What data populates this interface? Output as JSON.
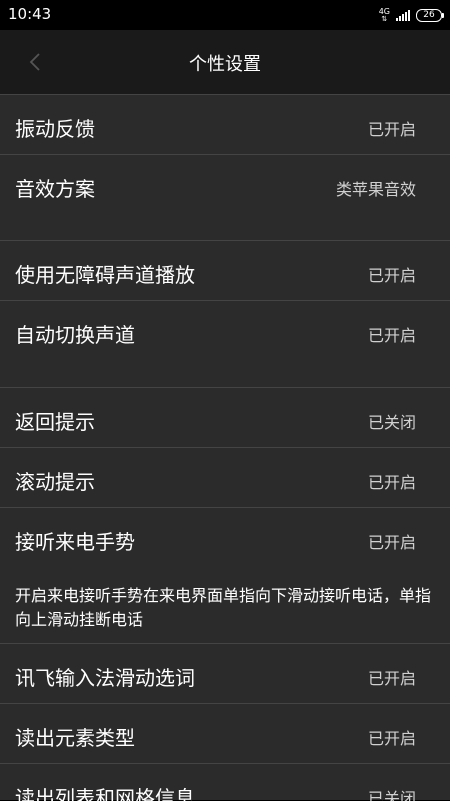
{
  "status_bar": {
    "time": "10:43",
    "network": "4G",
    "battery": "26"
  },
  "header": {
    "title": "个性设置"
  },
  "settings": [
    {
      "label": "振动反馈",
      "value": "已开启"
    },
    {
      "label": "音效方案",
      "value": "类苹果音效"
    },
    {
      "label": "使用无障碍声道播放",
      "value": "已开启"
    },
    {
      "label": "自动切换声道",
      "value": "已开启"
    },
    {
      "label": "返回提示",
      "value": "已关闭"
    },
    {
      "label": "滚动提示",
      "value": "已开启"
    },
    {
      "label": "接听来电手势",
      "value": "已开启"
    },
    {
      "label": "讯飞输入法滑动选词",
      "value": "已开启"
    },
    {
      "label": "读出元素类型",
      "value": "已开启"
    },
    {
      "label": "读出列表和网格信息",
      "value": "已关闭"
    }
  ],
  "gesture_description": "开启来电接听手势在来电界面单指向下滑动接听电话，单指向上滑动挂断电话",
  "colors": {
    "background": "#2b2b2b",
    "header": "#1a1a1a",
    "divider": "#444444"
  }
}
